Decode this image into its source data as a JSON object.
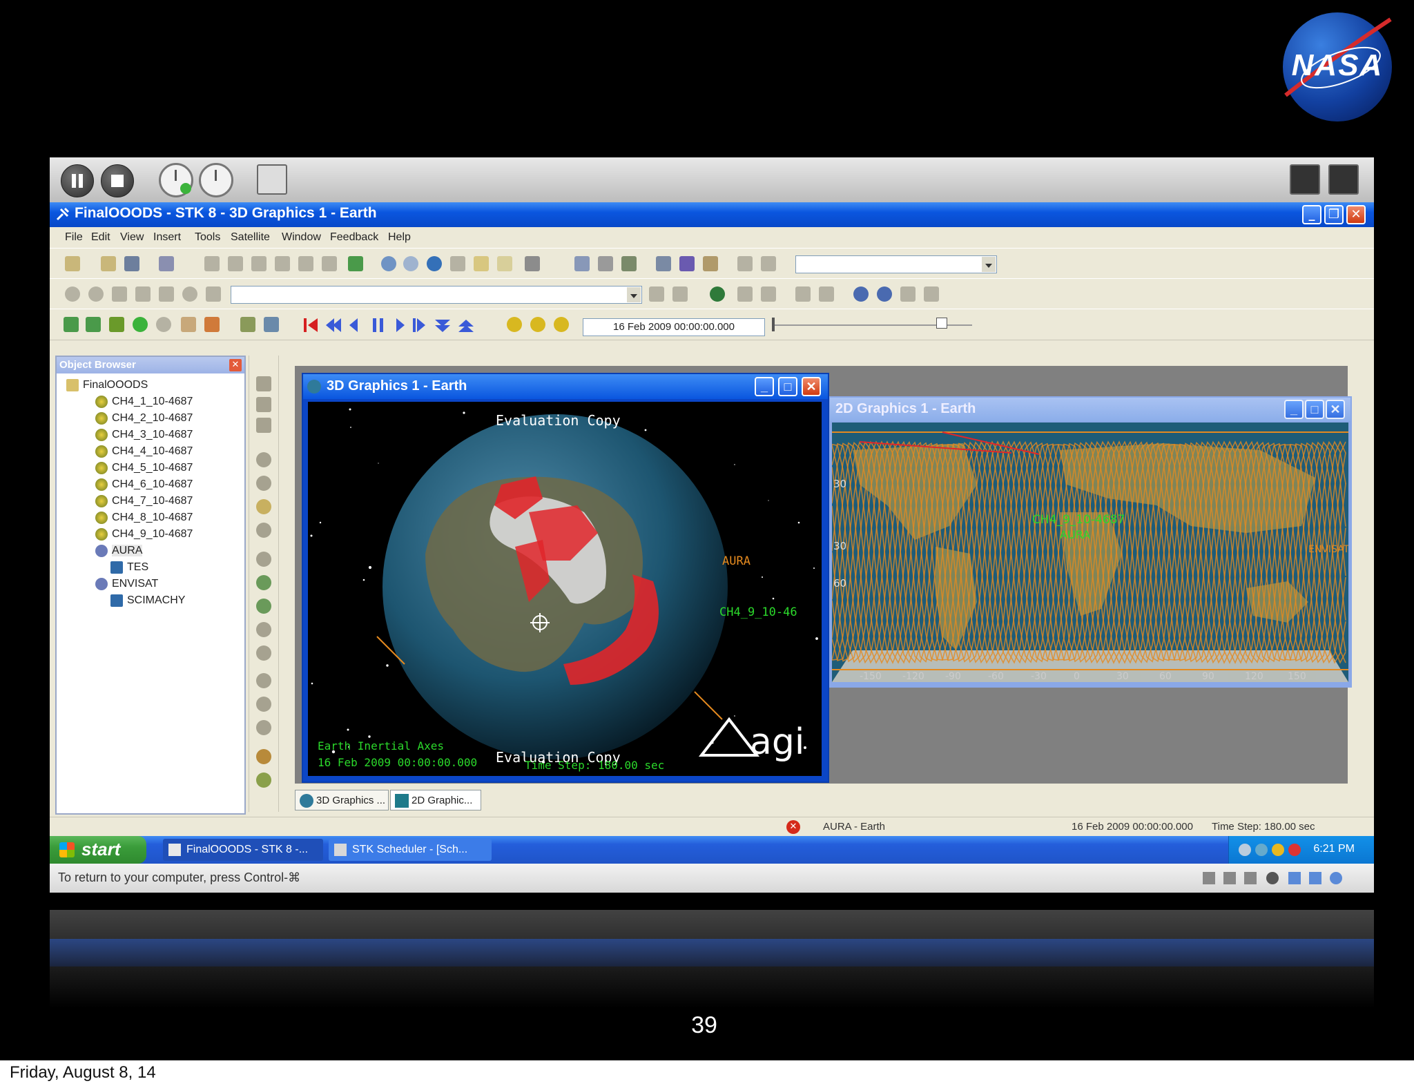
{
  "window": {
    "title": "FinalOOODS - STK 8 - 3D Graphics 1 - Earth"
  },
  "menu": [
    "File",
    "Edit",
    "View",
    "Insert",
    "Tools",
    "Satellite",
    "Window",
    "Feedback",
    "Help"
  ],
  "toolbar": {
    "time_value": "16 Feb 2009 00:00:00.000"
  },
  "object_browser": {
    "title": "Object Browser",
    "items": [
      {
        "label": "FinalOOODS",
        "level": 0
      },
      {
        "label": "CH4_1_10-4687",
        "level": 1
      },
      {
        "label": "CH4_2_10-4687",
        "level": 1
      },
      {
        "label": "CH4_3_10-4687",
        "level": 1
      },
      {
        "label": "CH4_4_10-4687",
        "level": 1
      },
      {
        "label": "CH4_5_10-4687",
        "level": 1
      },
      {
        "label": "CH4_6_10-4687",
        "level": 1
      },
      {
        "label": "CH4_7_10-4687",
        "level": 1
      },
      {
        "label": "CH4_8_10-4687",
        "level": 1
      },
      {
        "label": "CH4_9_10-4687",
        "level": 1
      },
      {
        "label": "AURA",
        "level": 1
      },
      {
        "label": "TES",
        "level": 2
      },
      {
        "label": "ENVISAT",
        "level": 1
      },
      {
        "label": "SCIMACHY",
        "level": 2
      }
    ]
  },
  "view3d": {
    "title": "3D Graphics 1 - Earth",
    "eval_top": "Evaluation Copy",
    "eval_bottom": "Evaluation Copy",
    "axes_label": "Earth Inertial Axes",
    "time_label": "16 Feb 2009 00:00:00.000",
    "step_label": "Time Step: 180.00 sec",
    "label_aura": "AURA",
    "label_ch4": "CH4_9_10-46",
    "logo": "agi"
  },
  "view2d": {
    "title": "2D Graphics 1 - Earth",
    "label_ch4": "CH4_9_10-4687",
    "label_aura": "AURA",
    "label_envisat": "ENVISAT",
    "lat_labels": [
      "30",
      "30",
      "60"
    ],
    "lon_labels": [
      "-150",
      "-120",
      "-90",
      "-60",
      "-30",
      "0",
      "30",
      "60",
      "90",
      "120",
      "150"
    ]
  },
  "tabs": [
    "3D Graphics ...",
    "2D Graphic..."
  ],
  "status": {
    "object": "AURA - Earth",
    "time": "16 Feb 2009 00:00:00.000",
    "step": "Time Step: 180.00 sec"
  },
  "taskbar": {
    "start": "start",
    "tasks": [
      "FinalOOODS - STK 8 -...",
      "STK Scheduler - [Sch..."
    ],
    "clock": "6:21 PM"
  },
  "vnc": {
    "message": "To return to your computer, press Control-⌘"
  },
  "slide": {
    "logo_text": "NASA",
    "page_number": "39",
    "footer_date": "Friday, August 8, 14"
  },
  "colors": {
    "xp_blue": "#0a56df",
    "xp_green": "#3a9c3a",
    "orbit_orange": "#e58a1f",
    "swath_red": "#e0262a",
    "label_green": "#2bd92b"
  },
  "icons": [
    "pause-icon",
    "stop-icon",
    "clock-add-icon",
    "clock-icon",
    "device-icon",
    "fullscreen-icon",
    "satellite-icon",
    "globe-icon",
    "close-icon"
  ]
}
